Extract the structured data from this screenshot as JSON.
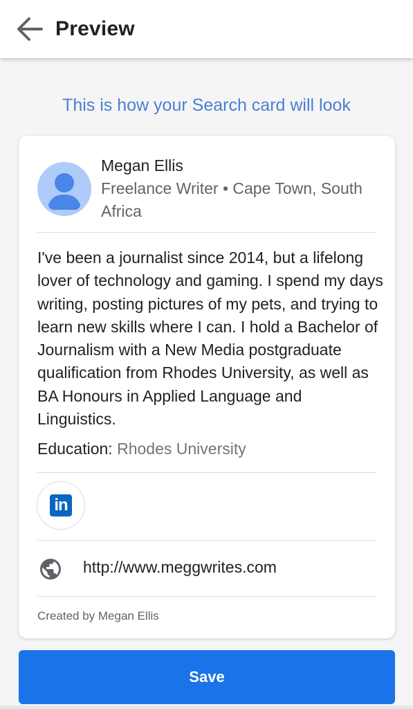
{
  "header": {
    "back_icon": "arrow-left-icon",
    "title": "Preview"
  },
  "subtitle": "This is how your Search card will look",
  "card": {
    "avatar_icon": "person-avatar-icon",
    "name": "Megan Ellis",
    "meta": "Freelance Writer • Cape Town, South Africa",
    "bio": "I've been a journalist since 2014, but a lifelong lover of technology and gaming. I spend my days writing, posting pictures of my pets, and trying to learn new skills where I can. I hold a Bachelor of Journalism with a New Media postgraduate qualification from Rhodes University, as well as BA Honours in Applied Language and Linguistics.",
    "education_label": "Education:",
    "education_value": "Rhodes University",
    "linkedin_icon": "linkedin-icon",
    "linkedin_text": "in",
    "website_icon": "globe-icon",
    "website": "http://www.meggwrites.com",
    "creator": "Created by Megan Ellis"
  },
  "save_label": "Save",
  "colors": {
    "accent": "#1a73e8",
    "subtitle": "#4a7fd4",
    "linkedin": "#0a66c2",
    "avatar": "#aecbfa",
    "avatar_figure": "#4a86e8"
  }
}
